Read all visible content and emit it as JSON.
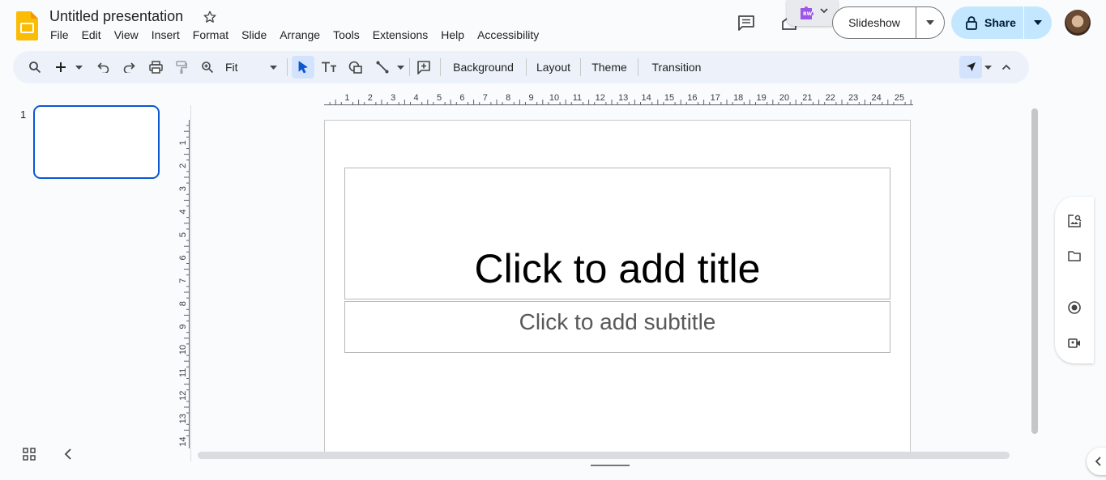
{
  "app": {
    "doc_title": "Untitled presentation",
    "brand_color": "#fbbc04"
  },
  "menu": [
    "File",
    "Edit",
    "View",
    "Insert",
    "Format",
    "Slide",
    "Arrange",
    "Tools",
    "Extensions",
    "Help",
    "Accessibility"
  ],
  "header": {
    "slideshow_label": "Slideshow",
    "share_label": "Share",
    "share_color": "#c2e7ff"
  },
  "toolbar": {
    "zoom_label": "Fit",
    "background_label": "Background",
    "layout_label": "Layout",
    "theme_label": "Theme",
    "transition_label": "Transition"
  },
  "filmstrip": {
    "slide_number": "1",
    "selected_color": "#0b57d0"
  },
  "slide": {
    "title_placeholder": "Click to add title",
    "subtitle_placeholder": "Click to add subtitle"
  },
  "rulers": {
    "horizontal": [
      "1",
      "2",
      "3",
      "4",
      "5",
      "6",
      "7",
      "8",
      "9",
      "10",
      "11",
      "12",
      "13",
      "14",
      "15",
      "16",
      "17",
      "18",
      "19",
      "20",
      "21",
      "22",
      "23",
      "24",
      "25"
    ],
    "vertical": [
      "1",
      "2",
      "3",
      "4",
      "5",
      "6",
      "7",
      "8",
      "9",
      "10",
      "11",
      "12",
      "13",
      "14"
    ]
  },
  "icons": {
    "extension": "puzzle-icon",
    "comments": "comment-icon",
    "share": "lock-icon"
  }
}
